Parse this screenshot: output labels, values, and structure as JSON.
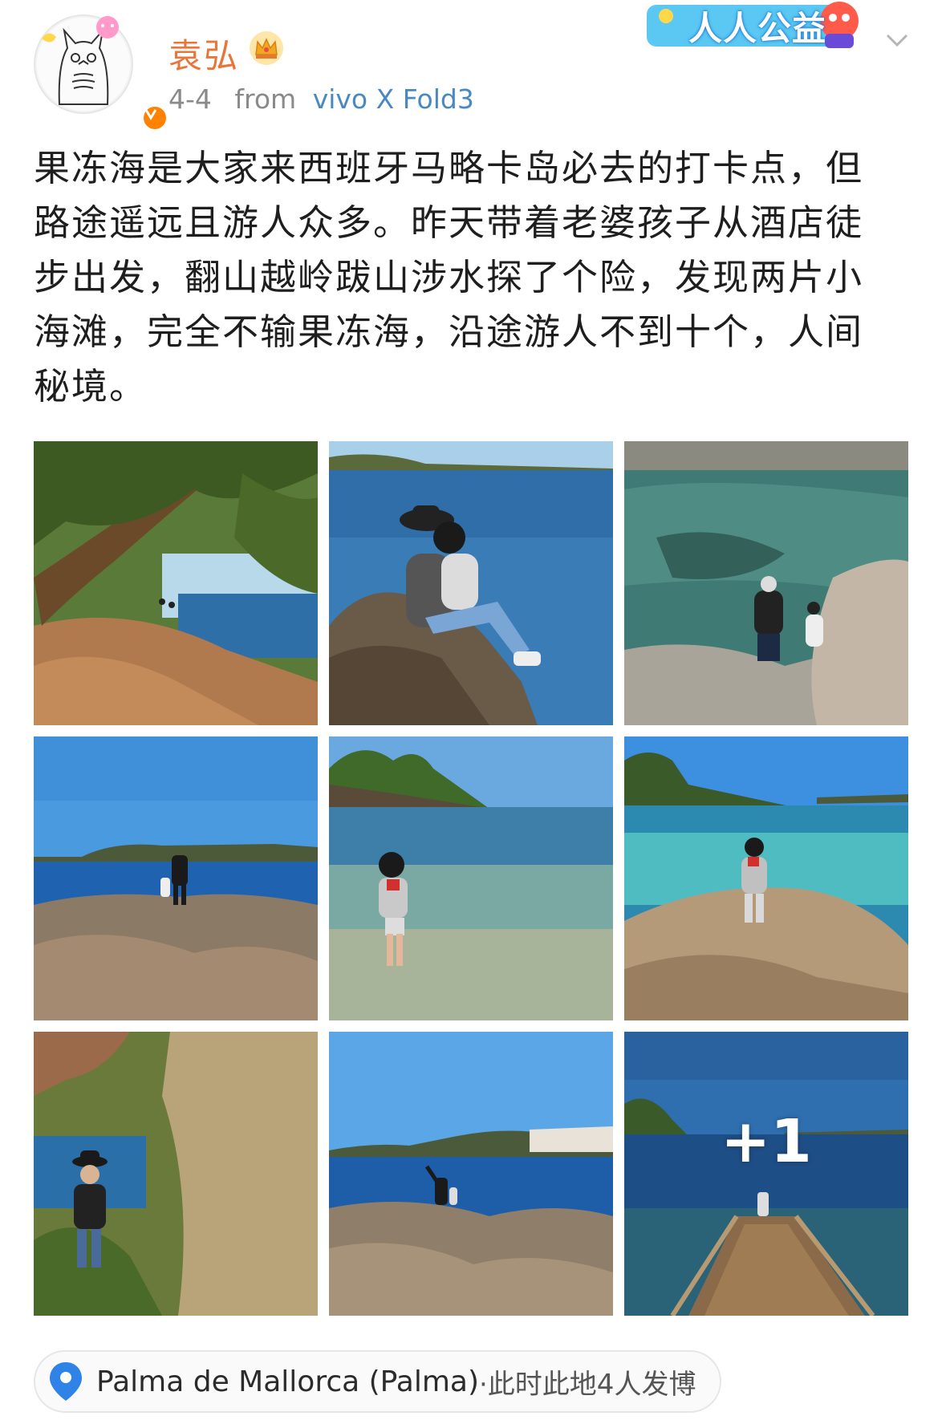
{
  "post": {
    "username": "袁弘",
    "date": "4-4",
    "source_prefix": "from",
    "source_device": "vivo X Fold3",
    "badge_text": "人人公益",
    "text": "果冻海是大家来西班牙马略卡岛必去的打卡点，但\n路途遥远且游人众多。昨天带着老婆孩子从酒店徒\n步出发，翻山越岭跋山涉水探了个险，发现两片小\n海滩，完全不输果冻海，沿途游人不到十个，人间\n秘境。"
  },
  "photos": {
    "more_overlay": "+1"
  },
  "location": {
    "place": "Palma de Mallorca (Palma)",
    "extra": "·此时此地4人发博"
  },
  "colors": {
    "username": "#e8763a",
    "source_link": "#4a88c2",
    "verified": "#ff8200",
    "location_pin": "#2f83e6"
  },
  "icons": [
    "avatar-totoro",
    "verified-icon",
    "crown-icon",
    "chevron-down-icon",
    "location-pin-icon"
  ]
}
